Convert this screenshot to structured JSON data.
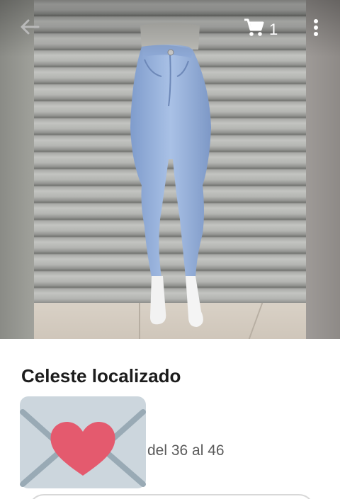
{
  "header": {
    "back_icon": "arrow-left-icon",
    "cart_icon": "cart-icon",
    "cart_count": "1",
    "menu_icon": "more-vert-icon"
  },
  "product": {
    "title": "Celeste localizado",
    "emoji_icon": "love-letter-icon",
    "size_text": "del 36 al 46"
  },
  "colors": {
    "heart": "#e45a6e",
    "envelope": "#ccd6dd",
    "envelope_lines": "#99aab5"
  }
}
